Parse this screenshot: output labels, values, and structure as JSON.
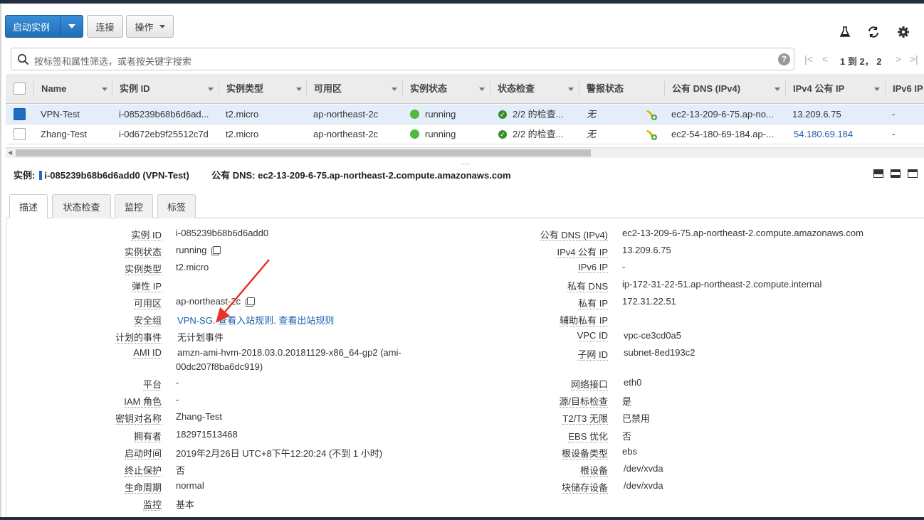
{
  "toolbar": {
    "launch_label": "启动实例",
    "connect_label": "连接",
    "actions_label": "操作"
  },
  "icons": [
    "flask-icon",
    "refresh-icon",
    "gear-icon",
    "search-icon",
    "help-icon"
  ],
  "search": {
    "placeholder": "按标签和属性筛选，或者按关键字搜索"
  },
  "pager": {
    "text": "1 到 2， 2"
  },
  "table": {
    "columns": [
      "Name",
      "实例 ID",
      "实例类型",
      "可用区",
      "实例状态",
      "状态检查",
      "警报状态",
      "公有 DNS (IPv4)",
      "IPv4 公有 IP",
      "IPv6 IP"
    ],
    "rows": [
      {
        "name": "VPN-Test",
        "id": "i-085239b68b6d6ad...",
        "type": "t2.micro",
        "az": "ap-northeast-2c",
        "state": "running",
        "checks": "2/2 的检查...",
        "alarm": "无",
        "dns": "ec2-13-209-6-75.ap-no...",
        "ipv4": "13.209.6.75",
        "ipv6": "-",
        "selected": true
      },
      {
        "name": "Zhang-Test",
        "id": "i-0d672eb9f25512c7d",
        "type": "t2.micro",
        "az": "ap-northeast-2c",
        "state": "running",
        "checks": "2/2 的检查...",
        "alarm": "无",
        "dns": "ec2-54-180-69-184.ap-...",
        "ipv4": "54.180.69.184",
        "ipv6": "-",
        "selected": false
      }
    ]
  },
  "detail": {
    "instance_prefix": "实例:",
    "instance_value": "i-085239b68b6d6add0 (VPN-Test)",
    "dns_prefix": "公有 DNS:",
    "dns_value": "ec2-13-209-6-75.ap-northeast-2.compute.amazonaws.com"
  },
  "tabs": [
    "描述",
    "状态检查",
    "监控",
    "标签"
  ],
  "left_fields": [
    {
      "label": "实例 ID",
      "value": "i-085239b68b6d6add0"
    },
    {
      "label": "实例状态",
      "value": "running"
    },
    {
      "label": "实例类型",
      "value": "t2.micro"
    },
    {
      "label": "弹性 IP",
      "value": ""
    },
    {
      "label": "可用区",
      "value": "ap-northeast-2c"
    },
    {
      "label": "安全组",
      "value": "VPN-SG",
      "link1": "查看入站规则",
      "link2": "查看出站规则",
      "sep": "."
    },
    {
      "label": "计划的事件",
      "value": "无计划事件"
    },
    {
      "label": "AMI ID",
      "value": "amzn-ami-hvm-2018.03.0.20181129-x86_64-gp2 (ami-",
      "value2": "00dc207f8ba6dc919)"
    },
    {
      "label": "平台",
      "value": "-"
    },
    {
      "label": "IAM 角色",
      "value": "-"
    },
    {
      "label": "密钥对名称",
      "value": "Zhang-Test"
    },
    {
      "label": "拥有者",
      "value": "182971513468"
    },
    {
      "label": "启动时间",
      "value": "2019年2月26日 UTC+8下午12:20:24 (不到 1 小时)"
    },
    {
      "label": "终止保护",
      "value": "否"
    },
    {
      "label": "生命周期",
      "value": "normal"
    },
    {
      "label": "监控",
      "value": "基本"
    }
  ],
  "right_fields": [
    {
      "label": "公有 DNS (IPv4)",
      "value": "ec2-13-209-6-75.ap-northeast-2.compute.amazonaws.com"
    },
    {
      "label": "IPv4 公有 IP",
      "value": "13.209.6.75"
    },
    {
      "label": "IPv6 IP",
      "value": "-"
    },
    {
      "label": "私有 DNS",
      "value": "ip-172-31-22-51.ap-northeast-2.compute.internal"
    },
    {
      "label": "私有 IP",
      "value": "172.31.22.51"
    },
    {
      "label": "辅助私有 IP",
      "value": ""
    },
    {
      "label": "VPC ID",
      "value": "vpc-ce3cd0a5"
    },
    {
      "label": "子网 ID",
      "value": "subnet-8ed193c2"
    },
    {
      "label": "网络接口",
      "value": "eth0"
    },
    {
      "label": "源/目标检查",
      "value": "是"
    },
    {
      "label": "T2/T3 无限",
      "value": "已禁用"
    },
    {
      "label": "EBS 优化",
      "value": "否"
    },
    {
      "label": "根设备类型",
      "value": "ebs"
    },
    {
      "label": "根设备",
      "value": "/dev/xvda"
    },
    {
      "label": "块储存设备",
      "value": "/dev/xvda"
    }
  ],
  "colors": {
    "accent": "#1f6dc7",
    "link": "#1b5fb2",
    "running": "#52b73b",
    "annotation_arrow": "#e8322a"
  }
}
